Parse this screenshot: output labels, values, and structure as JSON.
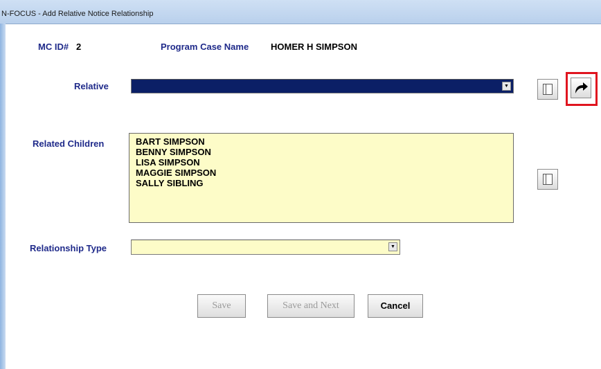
{
  "window": {
    "title": "N-FOCUS - Add Relative Notice Relationship"
  },
  "header": {
    "mc_id_label": "MC ID#",
    "mc_id_value": "2",
    "case_name_label": "Program Case Name",
    "case_name_value": "HOMER H SIMPSON"
  },
  "relative": {
    "label": "Relative",
    "selected": ""
  },
  "related_children": {
    "label": "Related Children",
    "items": [
      "BART SIMPSON",
      "BENNY SIMPSON",
      "LISA SIMPSON",
      "MAGGIE SIMPSON",
      "SALLY SIBLING"
    ]
  },
  "relationship_type": {
    "label": "Relationship Type",
    "selected": ""
  },
  "buttons": {
    "save": "Save",
    "save_next": "Save and Next",
    "cancel": "Cancel"
  },
  "colors": {
    "label": "#1f2a8a",
    "field": "#fdfcc8",
    "selected_field": "#0b1f66",
    "highlight": "#e0151f"
  },
  "icons": {
    "detail": "document-icon",
    "next": "arrow-right-curved-icon",
    "dropdown": "chevron-down-icon"
  }
}
